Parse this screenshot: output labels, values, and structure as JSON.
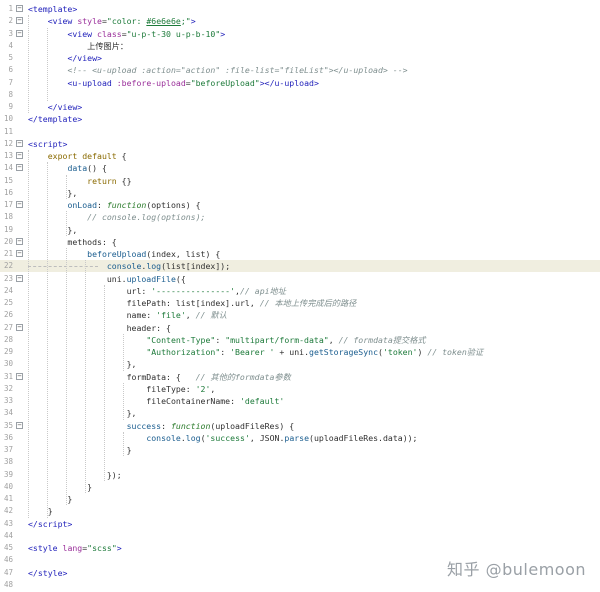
{
  "editor": {
    "highlighted_line": 22,
    "lines": [
      {
        "n": "1",
        "fold": "⊟",
        "html": "<span class='t'>&lt;template&gt;</span>"
      },
      {
        "n": "2",
        "fold": "⊟",
        "html": "    <span class='t'>&lt;view</span> <span class='a'>style</span>=<span class='s'>\"color: <u>#6e6e6e</u>;\"</span><span class='t'>&gt;</span>"
      },
      {
        "n": "3",
        "fold": "⊟",
        "html": "        <span class='t'>&lt;view</span> <span class='a'>class</span>=<span class='s'>\"u-p-t-30 u-p-b-10\"</span><span class='t'>&gt;</span>"
      },
      {
        "n": "4",
        "fold": "",
        "html": "            上传图片："
      },
      {
        "n": "5",
        "fold": "",
        "html": "        <span class='t'>&lt;/view&gt;</span>"
      },
      {
        "n": "6",
        "fold": "",
        "html": "        <span class='c'>&lt;!-- &lt;u-upload :action=\"action\" :file-list=\"fileList\"&gt;&lt;/u-upload&gt; --&gt;</span>"
      },
      {
        "n": "7",
        "fold": "",
        "html": "        <span class='t'>&lt;u-upload</span> <span class='a'>:before-upload</span>=<span class='s'>\"beforeUpload\"</span><span class='t'>&gt;&lt;/u-upload&gt;</span>"
      },
      {
        "n": "8",
        "fold": "",
        "html": ""
      },
      {
        "n": "9",
        "fold": "",
        "html": "    <span class='t'>&lt;/view&gt;</span>"
      },
      {
        "n": "10",
        "fold": "",
        "html": "<span class='t'>&lt;/template&gt;</span>"
      },
      {
        "n": "11",
        "fold": "",
        "html": ""
      },
      {
        "n": "12",
        "fold": "⊟",
        "html": "<span class='t'>&lt;script&gt;</span>"
      },
      {
        "n": "13",
        "fold": "⊟",
        "html": "    <span class='k'>export default</span> {"
      },
      {
        "n": "14",
        "fold": "⊟",
        "html": "        <span class='f'>data</span>() {"
      },
      {
        "n": "15",
        "fold": "",
        "html": "            <span class='k'>return</span> {}"
      },
      {
        "n": "16",
        "fold": "",
        "html": "        },"
      },
      {
        "n": "17",
        "fold": "⊟",
        "html": "        <span class='f'>onLoad</span>: <span class='kw'><i>function</i></span>(options) {"
      },
      {
        "n": "18",
        "fold": "",
        "html": "            <span class='c'>// console.log(options);</span>"
      },
      {
        "n": "19",
        "fold": "",
        "html": "        },"
      },
      {
        "n": "20",
        "fold": "⊟",
        "html": "        methods: {"
      },
      {
        "n": "21",
        "fold": "⊟",
        "html": "            <span class='f'>beforeUpload</span>(index, list) {"
      },
      {
        "n": "22",
        "fold": "",
        "html": "                <span class='f'>console</span>.<span class='f'>log</span>(list[index]);"
      },
      {
        "n": "23",
        "fold": "⊟",
        "html": "                uni.<span class='f'>uploadFile</span>({"
      },
      {
        "n": "24",
        "fold": "",
        "html": "                    url: <span class='s'>'---------------'</span>,<span class='c'>// api地址</span>"
      },
      {
        "n": "25",
        "fold": "",
        "html": "                    filePath: list[index].url, <span class='c'>// 本地上传完成后的路径</span>"
      },
      {
        "n": "26",
        "fold": "",
        "html": "                    name: <span class='s'>'file'</span>, <span class='c'>// 默认</span>"
      },
      {
        "n": "27",
        "fold": "⊟",
        "html": "                    header: {"
      },
      {
        "n": "28",
        "fold": "",
        "html": "                        <span class='s'>\"Content-Type\"</span>: <span class='s'>\"multipart/form-data\"</span>, <span class='c'>// formdata提交格式</span>"
      },
      {
        "n": "29",
        "fold": "",
        "html": "                        <span class='s'>\"Authorization\"</span>: <span class='s'>'Bearer '</span> + uni.<span class='f'>getStorageSync</span>(<span class='s'>'token'</span>) <span class='c'>// token验证</span>"
      },
      {
        "n": "30",
        "fold": "",
        "html": "                    },"
      },
      {
        "n": "31",
        "fold": "⊟",
        "html": "                    formData: {   <span class='c'>// 其他的formdata参数</span>"
      },
      {
        "n": "32",
        "fold": "",
        "html": "                        fileType: <span class='s'>'2'</span>,"
      },
      {
        "n": "33",
        "fold": "",
        "html": "                        fileContainerName: <span class='s'>'default'</span>"
      },
      {
        "n": "34",
        "fold": "",
        "html": "                    },"
      },
      {
        "n": "35",
        "fold": "⊟",
        "html": "                    <span class='f'>success</span>: <span class='kw'><i>function</i></span>(uploadFileRes) {"
      },
      {
        "n": "36",
        "fold": "",
        "html": "                        <span class='f'>console</span>.<span class='f'>log</span>(<span class='s'>'success'</span>, JSON.<span class='f'>parse</span>(uploadFileRes.data));"
      },
      {
        "n": "37",
        "fold": "",
        "html": "                    }"
      },
      {
        "n": "38",
        "fold": "",
        "html": ""
      },
      {
        "n": "39",
        "fold": "",
        "html": "                });"
      },
      {
        "n": "40",
        "fold": "",
        "html": "            }"
      },
      {
        "n": "41",
        "fold": "",
        "html": "        }"
      },
      {
        "n": "42",
        "fold": "",
        "html": "    }"
      },
      {
        "n": "43",
        "fold": "",
        "html": "<span class='t'>&lt;/script&gt;</span>"
      },
      {
        "n": "44",
        "fold": "",
        "html": ""
      },
      {
        "n": "45",
        "fold": "",
        "html": "<span class='t'>&lt;style</span> <span class='a'>lang</span>=<span class='s'>\"scss\"</span><span class='t'>&gt;</span>"
      },
      {
        "n": "46",
        "fold": "",
        "html": ""
      },
      {
        "n": "47",
        "fold": "",
        "html": "<span class='t'>&lt;/style&gt;</span>"
      },
      {
        "n": "48",
        "fold": "",
        "html": ""
      }
    ]
  },
  "watermark": "知乎 @bulemoon"
}
